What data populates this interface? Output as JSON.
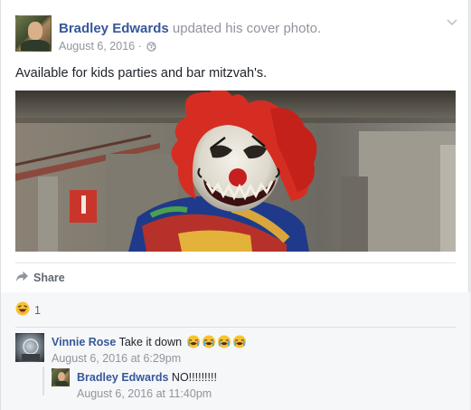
{
  "post": {
    "author": "Bradley Edwards",
    "action": " updated his cover photo.",
    "date": "August 6, 2016",
    "date_separator": " · ",
    "caption": "Available for kids parties and bar mitzvah's.",
    "icons": {
      "audience": "globe-icon",
      "menu": "chevron-down-icon"
    }
  },
  "actions": {
    "share_label": "Share",
    "share_icon": "share-arrow-icon"
  },
  "reactions": {
    "icon": "laughing-emoji-icon",
    "count": "1"
  },
  "comments": [
    {
      "author": "Vinnie Rose",
      "text": "Take it down",
      "emojis": [
        "crying-emoji-icon",
        "crying-emoji-icon",
        "crying-emoji-icon",
        "crying-emoji-icon"
      ],
      "timestamp": "August 6, 2016 at 6:29pm"
    },
    {
      "author": "Bradley Edwards",
      "text": "NO!!!!!!!!!",
      "timestamp": "August 6, 2016 at 11:40pm"
    }
  ],
  "colors": {
    "link": "#365899",
    "meta": "#90949c",
    "text": "#1d2129",
    "background": "#e9ebee"
  }
}
